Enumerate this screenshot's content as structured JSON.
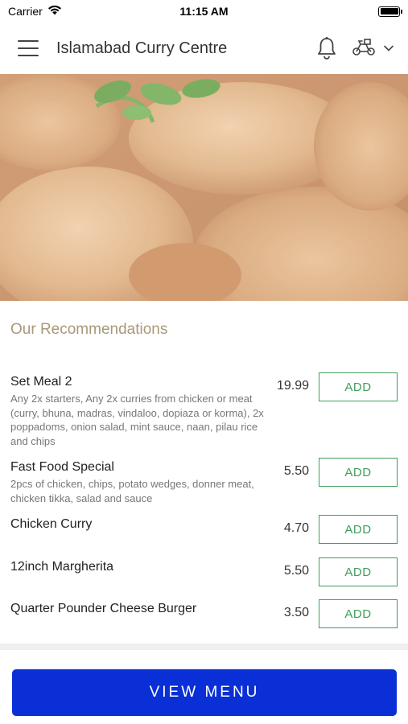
{
  "status_bar": {
    "carrier": "Carrier",
    "time": "11:15 AM"
  },
  "header": {
    "title": "Islamabad Curry Centre",
    "icons": [
      "menu-icon",
      "bell-icon",
      "scooter-icon",
      "chevron-down-icon"
    ]
  },
  "hero": {
    "icon": "food-photo"
  },
  "recommendations": {
    "title": "Our Recommendations",
    "items": [
      {
        "name": "Set Meal 2",
        "description": "Any 2x starters, Any 2x curries from chicken or meat (curry, bhuna, madras, vindaloo, dopiaza or korma), 2x poppadoms, onion salad, mint sauce, naan, pilau rice and chips",
        "price": "19.99",
        "button": "ADD"
      },
      {
        "name": "Fast Food Special",
        "description": "2pcs of chicken, chips, potato wedges, donner meat, chicken tikka, salad and sauce",
        "price": "5.50",
        "button": "ADD"
      },
      {
        "name": "Chicken Curry",
        "description": "",
        "price": "4.70",
        "button": "ADD"
      },
      {
        "name": "12inch Margherita",
        "description": "",
        "price": "5.50",
        "button": "ADD"
      },
      {
        "name": "Quarter Pounder Cheese Burger",
        "description": "",
        "price": "3.50",
        "button": "ADD"
      }
    ]
  },
  "footer": {
    "view_menu_label": "VIEW MENU"
  },
  "colors": {
    "accent_title": "#a89a78",
    "add_button": "#3f9d5a",
    "primary_button": "#0a2fd6"
  }
}
